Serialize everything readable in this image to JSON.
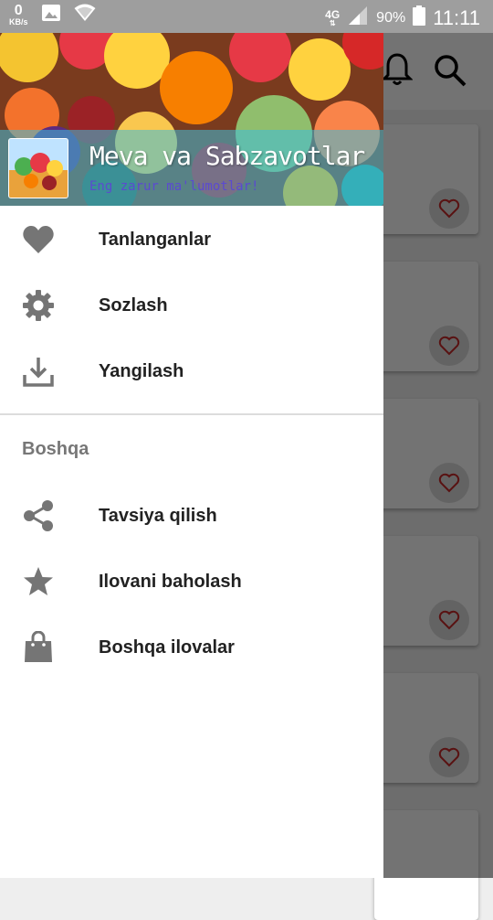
{
  "status_bar": {
    "speed_value": "0",
    "speed_unit": "KB/s",
    "network": "4G",
    "battery": "90%",
    "time": "11:11",
    "icons": [
      "image-icon",
      "wifi-icon",
      "signal-icon",
      "battery-icon"
    ]
  },
  "drawer": {
    "app_title": "Meva va Sabzavotlar",
    "app_subtitle": "Eng zarur ma'lumotlar!",
    "items": [
      {
        "label": "Tanlanganlar",
        "icon": "heart-icon"
      },
      {
        "label": "Sozlash",
        "icon": "gear-icon"
      },
      {
        "label": "Yangilash",
        "icon": "download-icon"
      }
    ],
    "section_title": "Boshqa",
    "other_items": [
      {
        "label": "Tavsiya qilish",
        "icon": "share-icon"
      },
      {
        "label": "Ilovani baholash",
        "icon": "star-icon"
      },
      {
        "label": "Boshqa ilovalar",
        "icon": "shopping-bag-icon"
      }
    ]
  },
  "colors": {
    "drawer_icon": "#757575",
    "menu_text": "#222222",
    "section_text": "#777777",
    "subtitle": "#5b4ad0",
    "card_heart": "#c62828"
  }
}
